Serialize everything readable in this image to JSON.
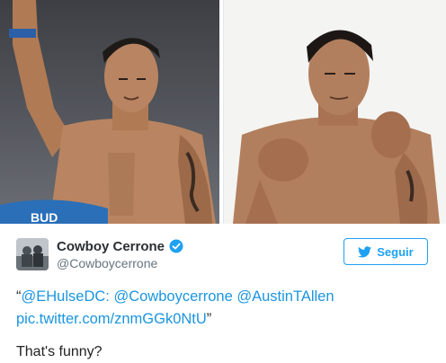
{
  "photos": {
    "left": {
      "banner_text": "BUD"
    },
    "right": {}
  },
  "tweet": {
    "author": {
      "display_name": "Cowboy Cerrone",
      "handle": "@Cowboycerrone",
      "verified": true
    },
    "follow_button": {
      "label": "Seguir",
      "icon": "twitter-bird-icon"
    },
    "text": {
      "open_quote": "“",
      "mention1": "@EHulseDC",
      "separator": ": ",
      "mention2": "@Cowboycerrone",
      "space": " ",
      "mention3": "@AustinTAllen",
      "link": "pic.twitter.com/znmGGk0NtU",
      "close_quote": "”"
    }
  },
  "caption": "That's funny?",
  "colors": {
    "link": "#1b95e0",
    "follow_border": "#1da1f2",
    "verified": "#1da1f2",
    "handle": "#66757f"
  }
}
